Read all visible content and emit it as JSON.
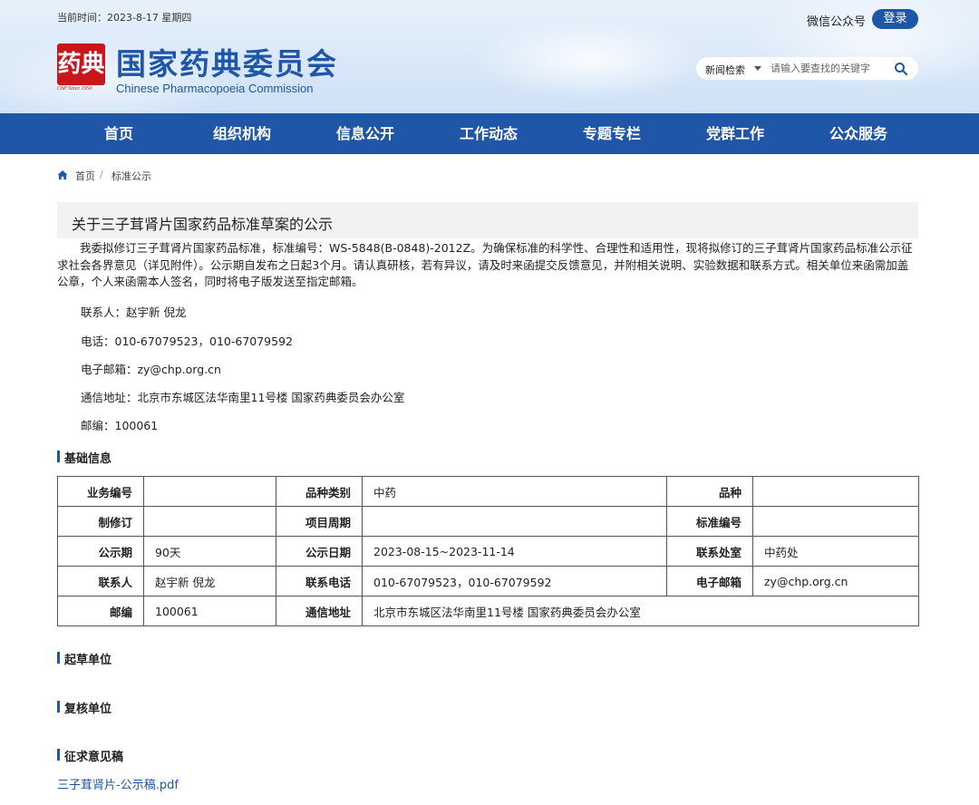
{
  "header": {
    "date_text": "当前时间：2023-8-17 星期四",
    "wechat_label": "微信公众号",
    "login_label": "登录",
    "logo_glyph": "药典",
    "logo_since": "ChP Since 1950",
    "title": "国家药典委员会",
    "subtitle": "Chinese Pharmacopoeia Commission",
    "search": {
      "category": "新闻检索",
      "placeholder": "请输入要查找的关键字"
    }
  },
  "nav": {
    "items": [
      "首页",
      "组织机构",
      "信息公开",
      "工作动态",
      "专题专栏",
      "党群工作",
      "公众服务"
    ]
  },
  "breadcrumb": {
    "home": "首页",
    "separator": "/",
    "current": "标准公示"
  },
  "article": {
    "title": "关于三子茸肾片国家药品标准草案的公示",
    "body": "我委拟修订三子茸肾片国家药品标准，标准编号：WS-5848(B-0848)-2012Z。为确保标准的科学性、合理性和适用性，现将拟修订的三子茸肾片国家药品标准公示征求社会各界意见（详见附件）。公示期自发布之日起3个月。请认真研核，若有异议，请及时来函提交反馈意见，并附相关说明、实验数据和联系方式。相关单位来函需加盖公章，个人来函需本人签名，同时将电子版发送至指定邮箱。",
    "contact_person": "联系人：赵宇新 倪龙",
    "phone": "电话：010-67079523，010-67079592",
    "email": "电子邮箱：zy@chp.org.cn",
    "address": "通信地址：北京市东城区法华南里11号楼 国家药典委员会办公室",
    "postcode": "邮编：100061"
  },
  "sections": {
    "basic_info": "基础信息",
    "drafting_unit": "起草单位",
    "review_unit": "复核单位",
    "draft_doc": "征求意见稿"
  },
  "info_table": {
    "rows": [
      [
        {
          "label": "业务编号",
          "value": ""
        },
        {
          "label": "品种类别",
          "value": "中药"
        },
        {
          "label": "品种",
          "value": ""
        }
      ],
      [
        {
          "label": "制修订",
          "value": ""
        },
        {
          "label": "项目周期",
          "value": ""
        },
        {
          "label": "标准编号",
          "value": ""
        }
      ],
      [
        {
          "label": "公示期",
          "value": "90天"
        },
        {
          "label": "公示日期",
          "value": "2023-08-15~2023-11-14"
        },
        {
          "label": "联系处室",
          "value": "中药处"
        }
      ],
      [
        {
          "label": "联系人",
          "value": "赵宇新 倪龙"
        },
        {
          "label": "联系电话",
          "value": "010-67079523，010-67079592"
        },
        {
          "label": "电子邮箱",
          "value": "zy@chp.org.cn"
        }
      ],
      [
        {
          "label": "邮编",
          "value": "100061"
        },
        {
          "label": "通信地址",
          "value": "北京市东城区法华南里11号楼 国家药典委员会办公室"
        }
      ]
    ]
  },
  "attachment": {
    "filename": "三子茸肾片-公示稿.pdf"
  },
  "colors": {
    "brand_blue": "#1f56a8",
    "logo_red": "#c8161d"
  }
}
